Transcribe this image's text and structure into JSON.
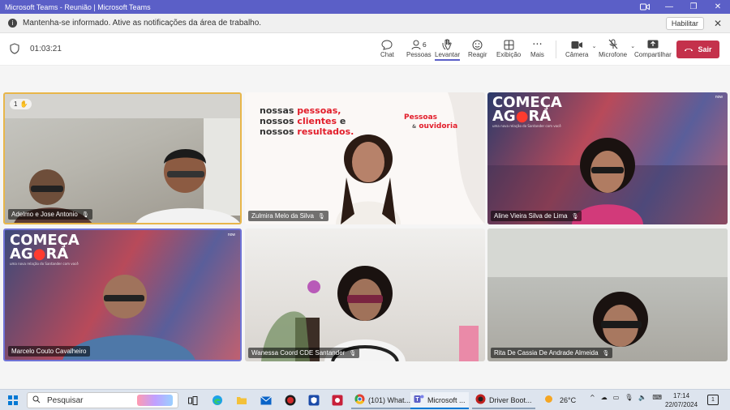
{
  "window": {
    "title": "Microsoft Teams - Reunião | Microsoft Teams"
  },
  "notification": {
    "message": "Mantenha-se informado. Ative as notificações da área de trabalho.",
    "enable_label": "Habilitar"
  },
  "toolbar": {
    "timer": "01:03:21",
    "participant_count": "6",
    "chat_label": "Chat",
    "people_label": "Pessoas",
    "raise_label": "Levantar",
    "react_label": "Reagir",
    "view_label": "Exibição",
    "more_label": "Mais",
    "camera_label": "Câmera",
    "mic_label": "Microfone",
    "share_label": "Compartilhar",
    "leave_label": "Sair"
  },
  "tiles": [
    {
      "name": "Adelmo e Jose Antonio",
      "hand_count": "1"
    },
    {
      "name": "Zulmira Melo da Silva",
      "banner_line1_a": "nossas ",
      "banner_line1_b": "pessoas,",
      "banner_line2_a": "nossos ",
      "banner_line2_b": "clientes",
      "banner_line2_c": " e",
      "banner_line3_a": "nossos ",
      "banner_line3_b": "resultados.",
      "badge_top": "Pessoas",
      "badge_amp": "&",
      "badge_bottom": "ouvidoria"
    },
    {
      "name": "Aline Vieira Silva de Lima",
      "bg_line1": "COMEÇA",
      "bg_line2_a": "AG",
      "bg_line2_b": "RA",
      "bg_sub": "uma nova relação do Santander com você",
      "corner_tag": "now"
    },
    {
      "name": "Marcelo Couto Cavalheiro",
      "bg_line1": "COMEÇA",
      "bg_line2_a": "AG",
      "bg_line2_b": "RA",
      "bg_sub": "uma nova relação do Santander com você",
      "corner_tag": "now"
    },
    {
      "name": "Wanessa Coord CDE Santander"
    },
    {
      "name": "Rita De Cassia De Andrade Almeida"
    }
  ],
  "taskbar": {
    "search_placeholder": "Pesquisar",
    "tasks": [
      {
        "label": "(101) What..."
      },
      {
        "label": "Microsoft ..."
      },
      {
        "label": "Driver Boot..."
      }
    ],
    "weather": "26°C",
    "time": "17:14",
    "date": "22/07/2024",
    "notification_count": "1"
  },
  "icons": {
    "accent": "#5b5fc7",
    "leave_color": "#c4314b",
    "active_tile_border": "#e8b64a",
    "speaking_tile_border": "#6f73d6"
  }
}
